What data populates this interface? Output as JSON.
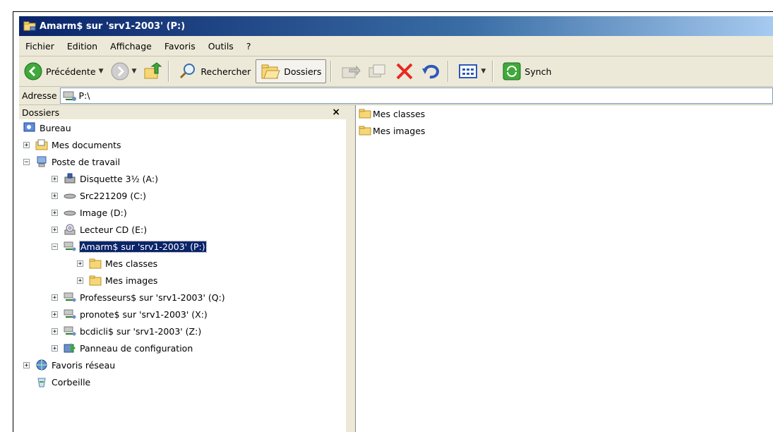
{
  "window": {
    "title": "Amarm$ sur 'srv1-2003' (P:)"
  },
  "menu": [
    "Fichier",
    "Edition",
    "Affichage",
    "Favoris",
    "Outils",
    "?"
  ],
  "toolbar": {
    "back_label": "Précédente",
    "search_label": "Rechercher",
    "folders_label": "Dossiers",
    "sync_label": "Synch"
  },
  "address": {
    "label": "Adresse",
    "value": "P:\\"
  },
  "folders_pane": {
    "title": "Dossiers",
    "close": "×"
  },
  "tree": {
    "desktop": "Bureau",
    "my_documents": "Mes documents",
    "my_computer": "Poste de travail",
    "floppy": "Disquette 3½ (A:)",
    "drive_c": "Src221209 (C:)",
    "drive_d": "Image (D:)",
    "drive_e": "Lecteur CD (E:)",
    "drive_p": "Amarm$ sur 'srv1-2003' (P:)",
    "p_classes": "Mes classes",
    "p_images": "Mes images",
    "drive_q": "Professeurs$ sur 'srv1-2003' (Q:)",
    "drive_x": "pronote$ sur 'srv1-2003' (X:)",
    "drive_z": "bcdicli$ sur 'srv1-2003' (Z:)",
    "control_panel": "Panneau de configuration",
    "network": "Favoris réseau",
    "recycle": "Corbeille"
  },
  "files": [
    "Mes classes",
    "Mes images"
  ],
  "colors": {
    "title_start": "#0a246a",
    "chrome": "#ece9d8",
    "selection": "#0a246a"
  }
}
